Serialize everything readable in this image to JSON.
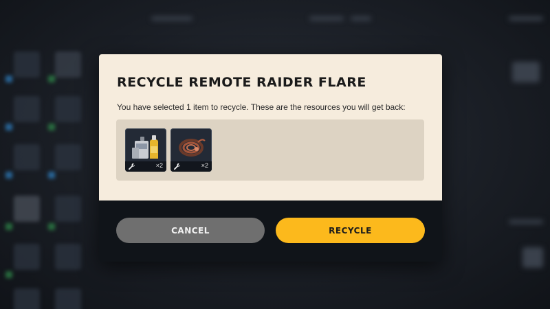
{
  "dialog": {
    "title": "RECYCLE REMOTE RAIDER FLARE",
    "description": "You have selected 1 item to recycle. These are the resources you will get back:",
    "resources": [
      {
        "icon": "chemicals-canisters-icon",
        "quantity": "×2"
      },
      {
        "icon": "wire-coil-icon",
        "quantity": "×2"
      }
    ],
    "buttons": {
      "cancel_label": "CANCEL",
      "recycle_label": "RECYCLE"
    }
  },
  "colors": {
    "dialog_background": "#f6ecdd",
    "tray_background": "#ddd3c3",
    "footer_background": "#101419",
    "cancel_button": "#6f6f6f",
    "recycle_button": "#fcb91c"
  }
}
